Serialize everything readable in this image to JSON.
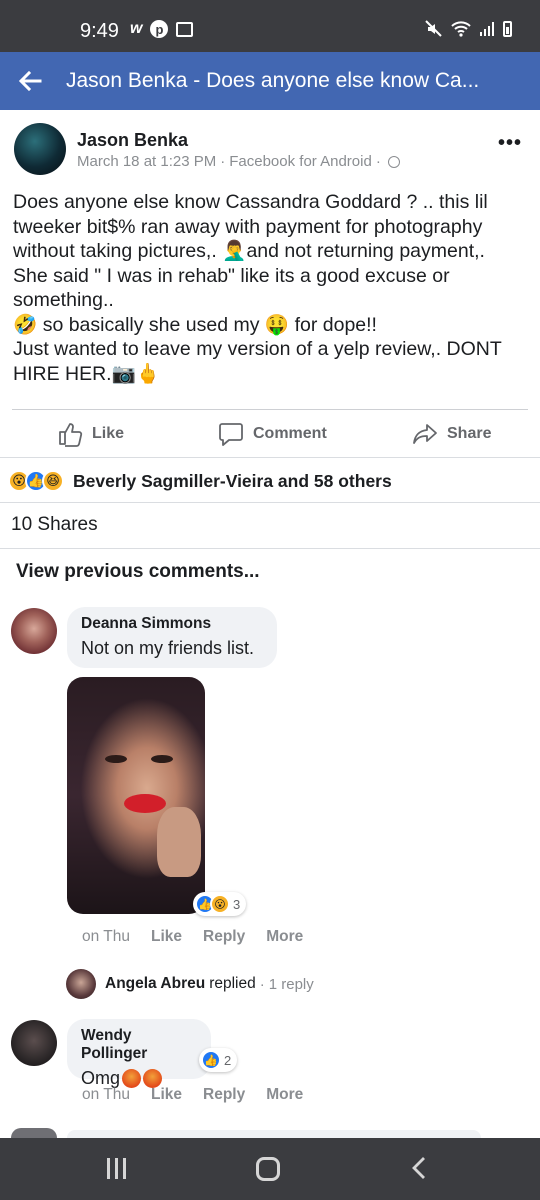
{
  "status_bar": {
    "time": "9:49",
    "left_icons": [
      "w-app-icon",
      "pinterest-icon",
      "image-icon"
    ],
    "right_icons": [
      "mute-icon",
      "wifi-icon",
      "signal-icon",
      "battery-icon"
    ]
  },
  "header": {
    "title": "Jason Benka - Does anyone else know Ca..."
  },
  "post": {
    "author": "Jason Benka",
    "date": "March 18 at 1:23 PM",
    "source": "Facebook for Android",
    "meta_sep": "·",
    "lines": [
      "Does anyone else know Cassandra Goddard ? .. this lil tweeker bit$% ran away with payment for photography without taking pictures,. 🤦‍♂️and not returning payment,. She said \" I was in rehab\" like its a good excuse or something..",
      "🤣 so basically she used my 🤑 for dope!!",
      "Just wanted to leave my version of a yelp review,. DONT HIRE HER.📷🖕"
    ]
  },
  "actions": {
    "like": "Like",
    "comment": "Comment",
    "share": "Share"
  },
  "reactions": {
    "icons": [
      "😮",
      "👍",
      "😆"
    ],
    "summary": "Beverly Sagmiller-Vieira and 58 others"
  },
  "shares": "10 Shares",
  "view_previous": "View previous comments...",
  "comments": [
    {
      "name": "Deanna Simmons",
      "text": "Not on my friends list.",
      "photo_reaction_icons": [
        "👍",
        "😮"
      ],
      "photo_reaction_count": "3",
      "time": "on Thu",
      "like": "Like",
      "reply": "Reply",
      "more": "More",
      "reply_preview": {
        "name": "Angela Abreu",
        "word": "replied",
        "sep": "·",
        "count": "1 reply"
      }
    },
    {
      "name": "Wendy Pollinger",
      "text": "Omg",
      "emoji_count": 2,
      "reaction_icons": [
        "👍"
      ],
      "reaction_count": "2",
      "time": "on Thu",
      "like": "Like",
      "reply": "Reply",
      "more": "More"
    }
  ],
  "colors": {
    "brand": "#4267b2",
    "system_bar": "#3b3c40",
    "bubble": "#f0f2f5",
    "muted": "#8a8d91",
    "like_blue": "#2078f4"
  }
}
